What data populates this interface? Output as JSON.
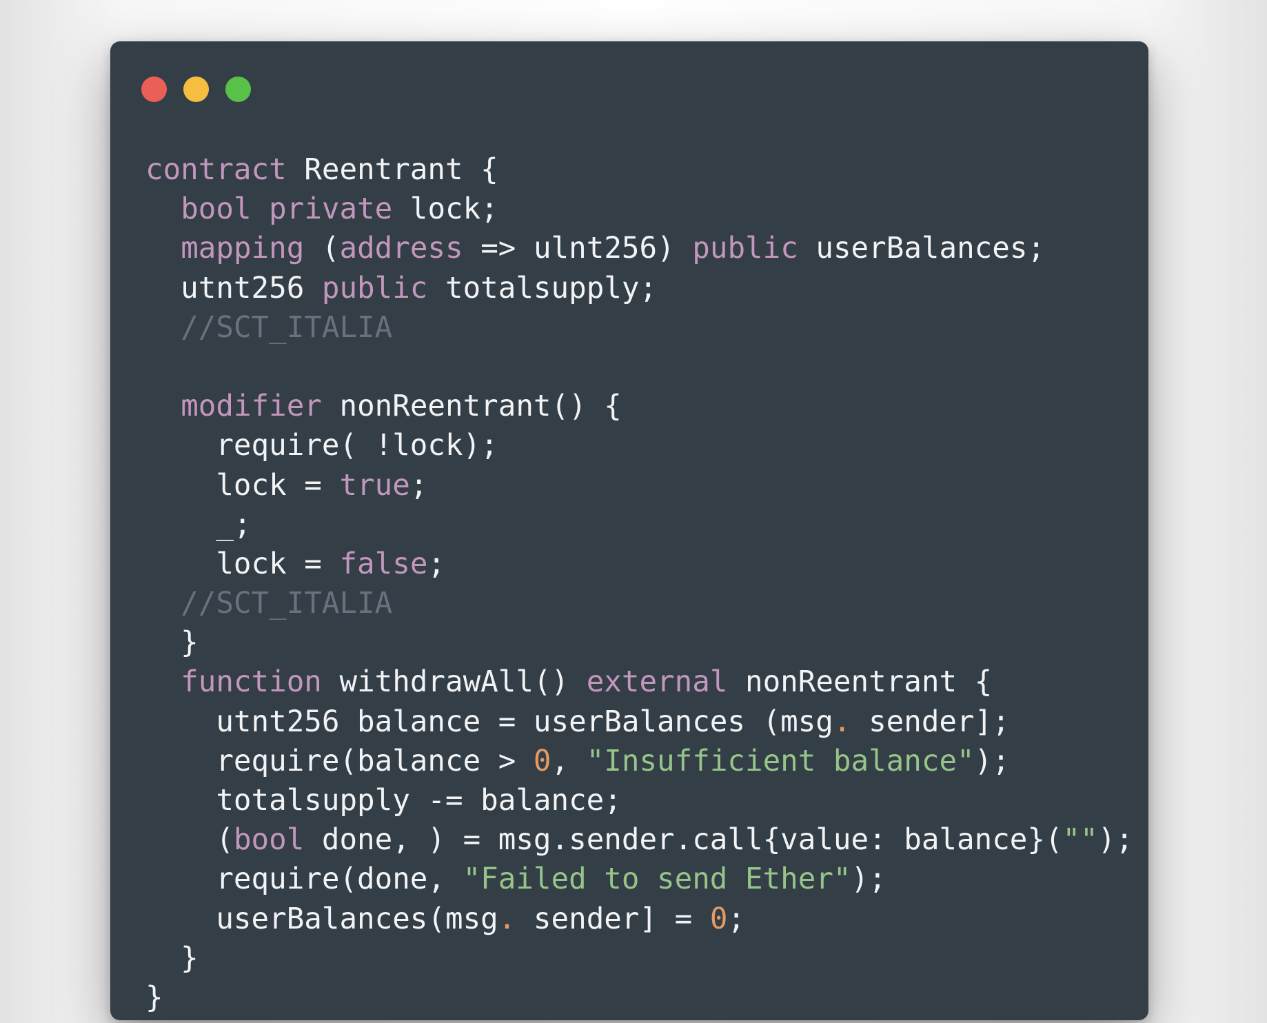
{
  "window": {
    "buttons": [
      {
        "name": "close-button",
        "color": "#ec5f57"
      },
      {
        "name": "minimize-button",
        "color": "#f6be40"
      },
      {
        "name": "maximize-button",
        "color": "#58c248"
      }
    ]
  },
  "colors": {
    "background": "#333e47",
    "text": "#f2f3f4",
    "keyword": "#c396bd",
    "comment": "#68727c",
    "string": "#96c489",
    "number": "#e59a62"
  },
  "code": {
    "lines": [
      [
        {
          "t": "kw",
          "v": "contract"
        },
        {
          "t": "",
          "v": " Reentrant {"
        }
      ],
      [
        {
          "t": "",
          "v": "  "
        },
        {
          "t": "kw",
          "v": "bool"
        },
        {
          "t": "",
          "v": " "
        },
        {
          "t": "kw",
          "v": "private"
        },
        {
          "t": "",
          "v": " lock;"
        }
      ],
      [
        {
          "t": "",
          "v": "  "
        },
        {
          "t": "kw",
          "v": "mapping"
        },
        {
          "t": "",
          "v": " ("
        },
        {
          "t": "kw",
          "v": "address"
        },
        {
          "t": "",
          "v": " => ulnt256) "
        },
        {
          "t": "kw",
          "v": "public"
        },
        {
          "t": "",
          "v": " userBalances;"
        }
      ],
      [
        {
          "t": "",
          "v": "  utnt256 "
        },
        {
          "t": "kw",
          "v": "public"
        },
        {
          "t": "",
          "v": " totalsupply;"
        }
      ],
      [
        {
          "t": "",
          "v": "  "
        },
        {
          "t": "cm",
          "v": "//SCT_ITALIA"
        }
      ],
      [
        {
          "t": "",
          "v": ""
        }
      ],
      [
        {
          "t": "",
          "v": "  "
        },
        {
          "t": "kw",
          "v": "modifier"
        },
        {
          "t": "",
          "v": " nonReentrant() {"
        }
      ],
      [
        {
          "t": "",
          "v": "    require( !lock);"
        }
      ],
      [
        {
          "t": "",
          "v": "    lock = "
        },
        {
          "t": "kw",
          "v": "true"
        },
        {
          "t": "",
          "v": ";"
        }
      ],
      [
        {
          "t": "",
          "v": "    _;"
        }
      ],
      [
        {
          "t": "",
          "v": "    lock = "
        },
        {
          "t": "kw",
          "v": "false"
        },
        {
          "t": "",
          "v": ";"
        }
      ],
      [
        {
          "t": "",
          "v": "  "
        },
        {
          "t": "cm",
          "v": "//SCT_ITALIA"
        }
      ],
      [
        {
          "t": "",
          "v": "  }"
        }
      ],
      [
        {
          "t": "",
          "v": "  "
        },
        {
          "t": "kw",
          "v": "function"
        },
        {
          "t": "",
          "v": " withdrawAll() "
        },
        {
          "t": "kw",
          "v": "external"
        },
        {
          "t": "",
          "v": " nonReentrant {"
        }
      ],
      [
        {
          "t": "",
          "v": "    utnt256 balance = userBalances (msg"
        },
        {
          "t": "pn",
          "v": "."
        },
        {
          "t": "",
          "v": " sender];"
        }
      ],
      [
        {
          "t": "",
          "v": "    require(balance > "
        },
        {
          "t": "num",
          "v": "0"
        },
        {
          "t": "",
          "v": ", "
        },
        {
          "t": "str",
          "v": "\"Insufficient balance\""
        },
        {
          "t": "",
          "v": ");"
        }
      ],
      [
        {
          "t": "",
          "v": "    totalsupply -= balance;"
        }
      ],
      [
        {
          "t": "",
          "v": "    ("
        },
        {
          "t": "kw",
          "v": "bool"
        },
        {
          "t": "",
          "v": " done, ) = msg.sender.call{value: balance}("
        },
        {
          "t": "str",
          "v": "\"\""
        },
        {
          "t": "",
          "v": ");"
        }
      ],
      [
        {
          "t": "",
          "v": "    require(done, "
        },
        {
          "t": "str",
          "v": "\"Failed to send Ether\""
        },
        {
          "t": "",
          "v": ");"
        }
      ],
      [
        {
          "t": "",
          "v": "    userBalances(msg"
        },
        {
          "t": "pn",
          "v": "."
        },
        {
          "t": "",
          "v": " sender] = "
        },
        {
          "t": "num",
          "v": "0"
        },
        {
          "t": "",
          "v": ";"
        }
      ],
      [
        {
          "t": "",
          "v": "  }"
        }
      ],
      [
        {
          "t": "",
          "v": "}"
        }
      ]
    ]
  }
}
